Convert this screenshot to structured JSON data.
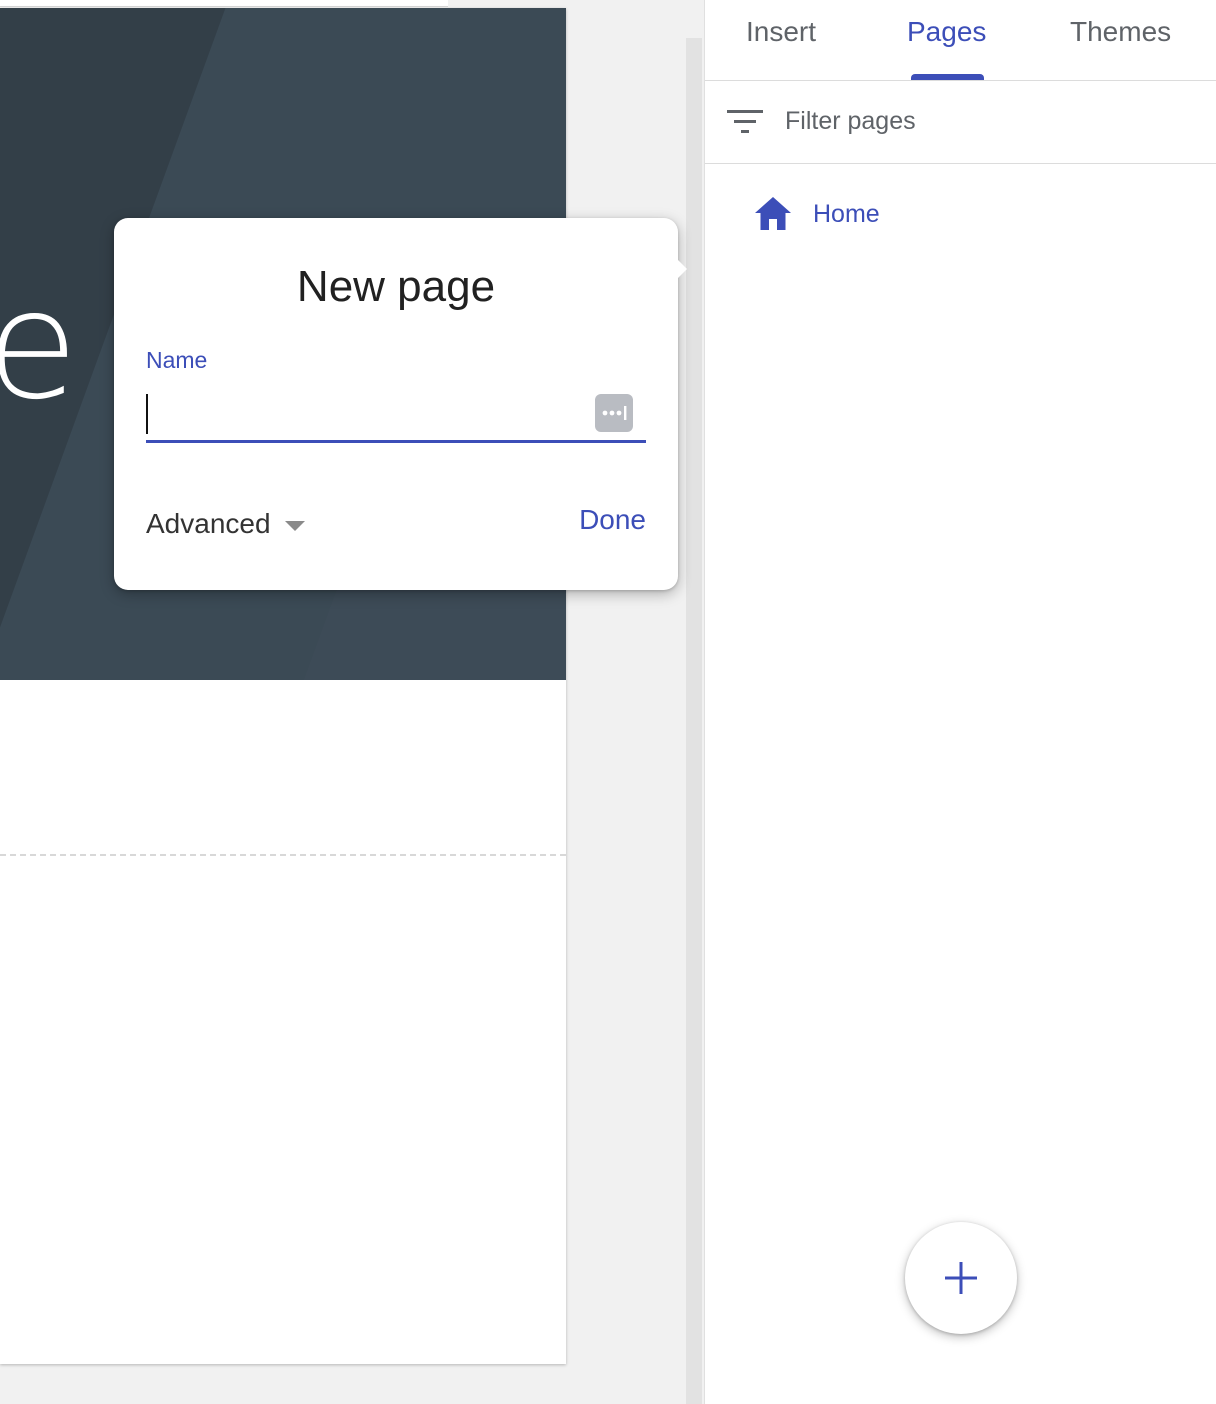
{
  "dialog": {
    "title": "New page",
    "name_label": "Name",
    "name_value": "",
    "advanced_label": "Advanced",
    "done_label": "Done"
  },
  "banner": {
    "visible_letter": "e"
  },
  "side_panel": {
    "tabs": [
      {
        "label": "Insert",
        "selected": false
      },
      {
        "label": "Pages",
        "selected": true
      },
      {
        "label": "Themes",
        "selected": false
      }
    ],
    "filter": {
      "placeholder": "Filter pages",
      "icon": "filter-icon"
    },
    "pages": [
      {
        "label": "Home",
        "icon": "home-icon"
      }
    ],
    "add_button_icon": "plus-icon"
  },
  "colors": {
    "accent": "#3c4eb8",
    "banner": "#3b4a55",
    "text_primary": "#212121",
    "text_secondary": "#5f6368"
  }
}
